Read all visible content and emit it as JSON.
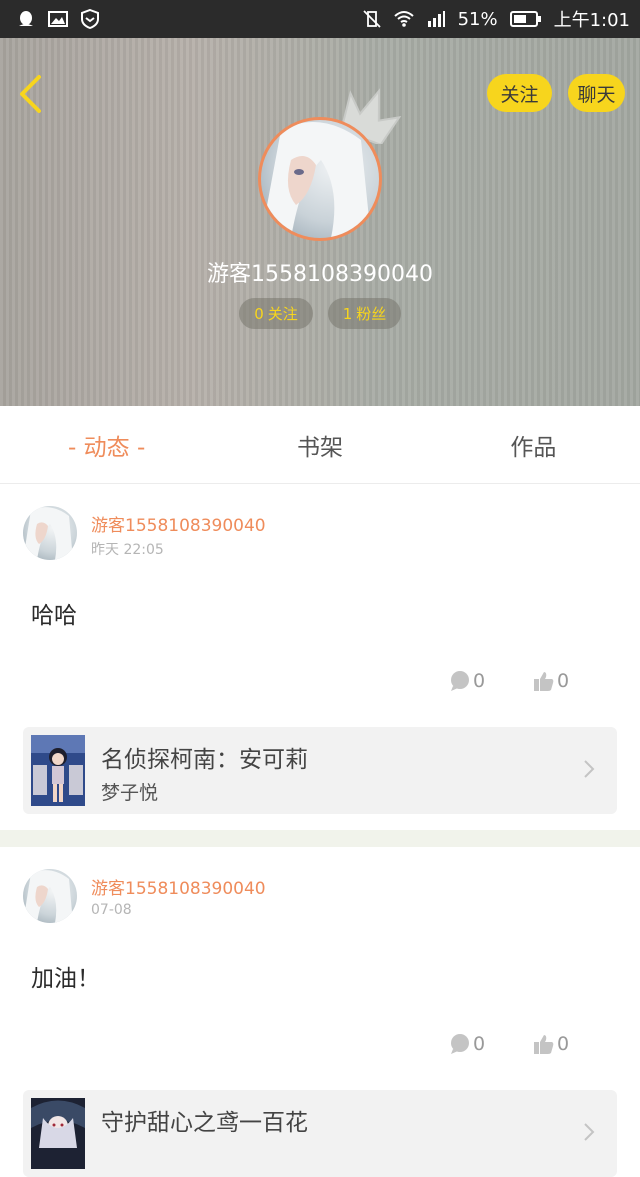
{
  "status_bar": {
    "battery": "51%",
    "time": "上午1:01"
  },
  "header": {
    "follow_label": "关注",
    "chat_label": "聊天",
    "username": "游客1558108390040",
    "following_count": "0",
    "following_label": "关注",
    "fans_count": "1",
    "fans_label": "粉丝"
  },
  "tabs": [
    {
      "label": "- 动态 -",
      "active": true
    },
    {
      "label": "书架",
      "active": false
    },
    {
      "label": "作品",
      "active": false
    }
  ],
  "posts": [
    {
      "username": "游客1558108390040",
      "time": "昨天 22:05",
      "text": "哈哈",
      "comments": "0",
      "likes": "0",
      "book": {
        "title": "名侦探柯南：安可莉",
        "author": "梦子悦"
      }
    },
    {
      "username": "游客1558108390040",
      "time": "07-08",
      "text": "加油！",
      "comments": "0",
      "likes": "0",
      "book": {
        "title": "守护甜心之鸢一百花",
        "author": ""
      }
    }
  ],
  "colors": {
    "accent": "#ef8c5b",
    "button_yellow": "#f7d51d",
    "status_bar": "#2b2b2b"
  }
}
